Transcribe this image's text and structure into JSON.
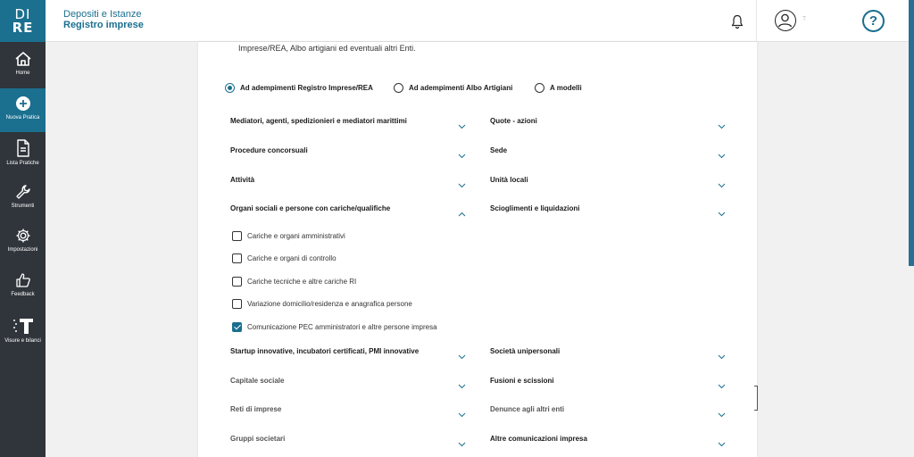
{
  "sidebar": {
    "logo_line1": "DI",
    "logo_line2": "RE",
    "items": [
      {
        "label": "Home",
        "icon": "home-icon"
      },
      {
        "label": "Nuova Pratica",
        "icon": "plus-circle-icon"
      },
      {
        "label": "Lista Pratiche",
        "icon": "document-icon"
      },
      {
        "label": "Strumenti",
        "icon": "wrench-icon"
      },
      {
        "label": "Impostazioni",
        "icon": "gear-icon"
      },
      {
        "label": "Feedback",
        "icon": "thumbs-up-icon"
      },
      {
        "label": "Visure e bilanci",
        "icon": "visure-icon"
      }
    ]
  },
  "header": {
    "title_line1": "Depositi e Istanze",
    "title_line2": "Registro imprese",
    "user_name": "T",
    "help_label": "?"
  },
  "main": {
    "intro_text": "Imprese/REA, Albo artigiani ed eventuali altri Enti.",
    "radios": [
      {
        "label": "Ad adempimenti Registro Imprese/REA",
        "checked": true
      },
      {
        "label": "Ad adempimenti Albo Artigiani",
        "checked": false
      },
      {
        "label": "A modelli",
        "checked": false
      }
    ],
    "left_sections_top": [
      {
        "label": "Mediatori, agenti, spedizionieri e mediatori marittimi",
        "expanded": false
      },
      {
        "label": "Procedure concorsuali",
        "expanded": false
      },
      {
        "label": "Attività",
        "expanded": false
      },
      {
        "label": "Organi sociali e persone con cariche/qualifiche",
        "expanded": true
      }
    ],
    "right_sections_top": [
      {
        "label": "Quote - azioni",
        "expanded": false
      },
      {
        "label": "Sede",
        "expanded": false
      },
      {
        "label": "Unità locali",
        "expanded": false
      },
      {
        "label": "Scioglimenti e liquidazioni",
        "expanded": false
      }
    ],
    "checkboxes": [
      {
        "label": "Cariche e organi amministrativi",
        "checked": false
      },
      {
        "label": "Cariche e organi di controllo",
        "checked": false
      },
      {
        "label": "Cariche tecniche e altre cariche RI",
        "checked": false
      },
      {
        "label": "Variazione domicilio/residenza e anagrafica persone",
        "checked": false
      },
      {
        "label": "Comunicazione PEC amministratori e altre persone impresa",
        "checked": true
      }
    ],
    "left_sections_bottom": [
      {
        "label": "Startup innovative, incubatori certificati, PMI innovative",
        "expanded": false
      },
      {
        "label": "Capitale sociale",
        "expanded": false
      },
      {
        "label": "Reti di imprese",
        "expanded": false
      },
      {
        "label": "Gruppi societari",
        "expanded": false
      }
    ],
    "right_sections_bottom": [
      {
        "label": "Società unipersonali",
        "expanded": false
      },
      {
        "label": "Fusioni e scissioni",
        "expanded": false
      },
      {
        "label": "Denunce agli altri enti",
        "expanded": false
      },
      {
        "label": "Altre comunicazioni impresa",
        "expanded": false
      }
    ]
  },
  "colors": {
    "brand": "#1b6f8f",
    "sidebar_bg": "#2f353b",
    "panel_bg": "#ffffff"
  }
}
